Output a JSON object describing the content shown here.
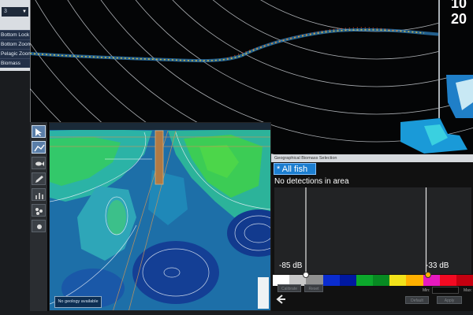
{
  "menu": {
    "dropdown_value": "3",
    "items": [
      "Bottom Lock",
      "Bottom Zoom",
      "Pelagic Zoom",
      "Biomass"
    ]
  },
  "sonar": {
    "readout_top": "10",
    "readout_bottom": "20"
  },
  "tools": [
    {
      "name": "pointer-tool",
      "icon": "cursor-icon"
    },
    {
      "name": "track-tool",
      "icon": "track-icon"
    },
    {
      "name": "fish-tool",
      "icon": "fish-icon"
    },
    {
      "name": "edit-tool",
      "icon": "pen-icon"
    },
    {
      "name": "chart-tool",
      "icon": "bar-chart-icon"
    },
    {
      "name": "school-tool",
      "icon": "school-icon"
    },
    {
      "name": "marker-tool",
      "icon": "marker-icon"
    }
  ],
  "map": {
    "status": "No geology available"
  },
  "panel": {
    "title": "Geographical Biomass Selection",
    "species_label": "* All fish",
    "no_detections": "No detections in area",
    "db_min": "-85 dB",
    "db_max": "-33 dB",
    "threshold_min_fraction": 0.16,
    "threshold_max_fraction": 0.77,
    "scale_colors": [
      "#ffffff",
      "#c8c8c8",
      "#909090",
      "#0a2ccf",
      "#0018a0",
      "#0ca82c",
      "#078a22",
      "#f2e21a",
      "#ffb000",
      "#e61abf",
      "#f20a22",
      "#c40010"
    ],
    "buttons": {
      "calibrate": "Calibrate",
      "reset": "Reset",
      "apply": "Apply",
      "default": "Default"
    },
    "min_label": "Min:",
    "max_label": "Max:"
  }
}
